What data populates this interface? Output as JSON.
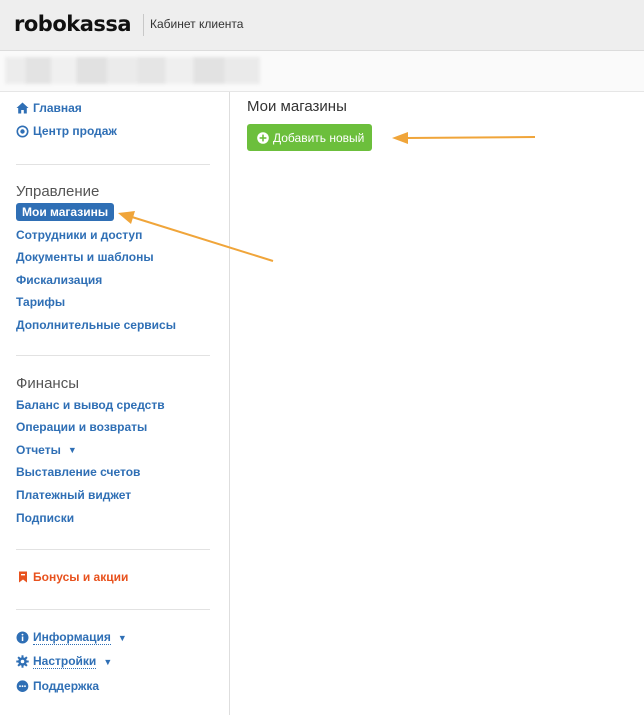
{
  "header": {
    "logo": "robokassa",
    "subtitle": "Кабинет клиента"
  },
  "sidebar": {
    "home": "Главная",
    "sales_center": "Центр продаж",
    "management": {
      "title": "Управление",
      "items": [
        "Мои магазины",
        "Сотрудники и доступ",
        "Документы и шаблоны",
        "Фискализация",
        "Тарифы",
        "Дополнительные сервисы"
      ]
    },
    "finance": {
      "title": "Финансы",
      "items": [
        "Баланс и вывод средств",
        "Операции и возвраты",
        "Отчеты",
        "Выставление счетов",
        "Платежный виджет",
        "Подписки"
      ]
    },
    "bonuses": "Бонусы и акции",
    "info": "Информация",
    "settings": "Настройки",
    "support": "Поддержка"
  },
  "main": {
    "title": "Мои магазины",
    "add_button": "Добавить новый"
  },
  "colors": {
    "link": "#2f6fb5",
    "active_bg": "#2f6fb5",
    "button_bg": "#6cbf3c",
    "bonus": "#e8521e",
    "annotation_arrow": "#f0a53a"
  }
}
